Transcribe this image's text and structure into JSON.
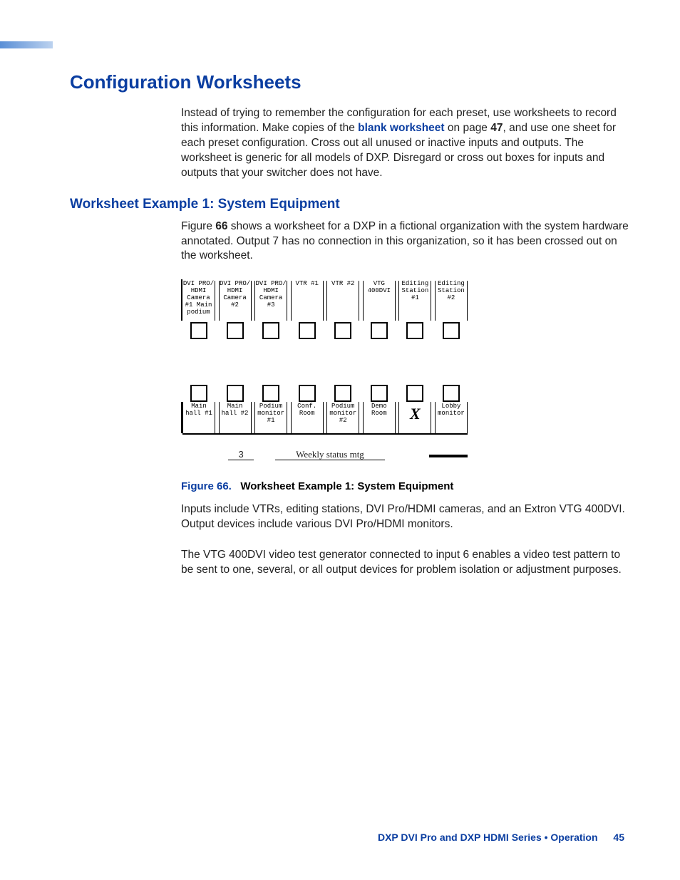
{
  "section_title": "Configuration Worksheets",
  "intro_pre": "Instead of trying to remember the configuration for each preset, use worksheets to record this information. Make copies of the ",
  "intro_link": "blank worksheet",
  "intro_mid": " on page ",
  "intro_page": "47",
  "intro_post": ", and use one sheet for each preset configuration. Cross out all unused or inactive inputs and outputs. The worksheet is generic for all models of DXP. Disregard or cross out boxes for inputs and outputs that your switcher does not have.",
  "subsection_title": "Worksheet Example 1: System Equipment",
  "sub_pre": "Figure ",
  "sub_fignum": "66",
  "sub_post": " shows a worksheet for a DXP in a fictional organization with the system hardware annotated. Output 7 has no connection in this organization, so it has been crossed out on the worksheet.",
  "worksheet": {
    "inputs": [
      "DVI PRO/ HDMI Camera #1 Main podium",
      "DVI PRO/ HDMI Camera #2",
      "DVI PRO/ HDMI Camera #3",
      "VTR #1",
      "VTR #2",
      "VTG 400DVI",
      "Editing Station #1",
      "Editing Station #2"
    ],
    "outputs": [
      "Main hall #1",
      "Main hall #2",
      "Podium monitor #1",
      "Conf. Room",
      "Podium monitor #2",
      "Demo Room",
      "X",
      "Lobby monitor"
    ],
    "preset_number": "3",
    "preset_title": "Weekly status mtg"
  },
  "figure_label": "Figure 66.",
  "figure_title": "Worksheet Example 1: System Equipment",
  "para2": "Inputs include VTRs, editing stations, DVI Pro/HDMI cameras, and an Extron VTG 400DVI. Output devices include various DVI Pro/HDMI monitors.",
  "para3": "The VTG 400DVI video test generator connected to input 6 enables a video test pattern to be sent to one, several, or all output devices for problem isolation or adjustment purposes.",
  "footer_text": "DXP DVI Pro and DXP HDMI Series • Operation",
  "page_number": "45"
}
